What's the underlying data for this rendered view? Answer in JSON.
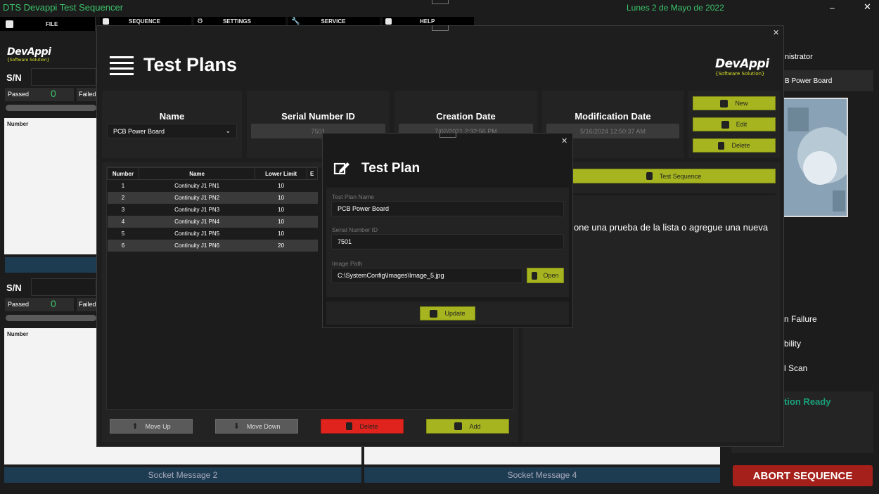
{
  "app": {
    "title": "DTS Devappi Test Sequencer",
    "date": "Lunes 2 de Mayo de 2022",
    "menu": [
      "FILE",
      "SEQUENCE",
      "SETTINGS",
      "SERVICE",
      "HELP"
    ],
    "brand": "DevAppi",
    "brand_tag": "{Software Solution}"
  },
  "left": {
    "sn_label": "S/N",
    "passed_label": "Passed",
    "passed_value": "0",
    "failed_label": "Failed",
    "number_col": "Number",
    "socket_message_2": "Socket Message 2",
    "socket_message_4": "Socket Message 4"
  },
  "right": {
    "role": "nistrator",
    "plan": "B Power Board",
    "opt1": "n Failure",
    "opt2": "bility",
    "opt3": "l Scan",
    "status": "tion Ready",
    "abort": "ABORT SEQUENCE"
  },
  "test_plans": {
    "title": "Test Plans",
    "col_name": "Name",
    "col_serial": "Serial Number ID",
    "col_created": "Creation Date",
    "col_modified": "Modification Date",
    "name_value": "PCB Power Board",
    "serial_value": "7501",
    "created_value": "7/02/2021 2:32:56 PM",
    "modified_value": "5/16/2024 12:50:37 AM",
    "btn_new": "New",
    "btn_edit": "Edit",
    "btn_delete": "Delete",
    "btn_test_sequence": "Test Sequence",
    "message": "one una prueba de la lista o agregue una nueva",
    "grid_headers": [
      "Number",
      "Name",
      "Lower Limit",
      "E"
    ],
    "grid_rows": [
      [
        "1",
        "Continuity J1 PN1",
        "10"
      ],
      [
        "2",
        "Continuity J1 PN2",
        "10"
      ],
      [
        "3",
        "Continuity J1 PN3",
        "10"
      ],
      [
        "4",
        "Continuity J1 PN4",
        "10"
      ],
      [
        "5",
        "Continuity J1 PN5",
        "10"
      ],
      [
        "6",
        "Continuity J1 PN6",
        "20"
      ]
    ],
    "btn_move_up": "Move Up",
    "btn_move_down": "Move Down",
    "btn_row_delete": "Delete",
    "btn_add": "Add"
  },
  "dialog": {
    "title": "Test Plan",
    "name_label": "Test Plan Name",
    "name_value": "PCB Power Board",
    "serial_label": "Serial Number ID",
    "serial_value": "7501",
    "path_label": "Image Path",
    "path_value": "C:\\SystemConfig\\Images\\Image_5.jpg",
    "btn_open": "Open",
    "btn_update": "Update"
  }
}
